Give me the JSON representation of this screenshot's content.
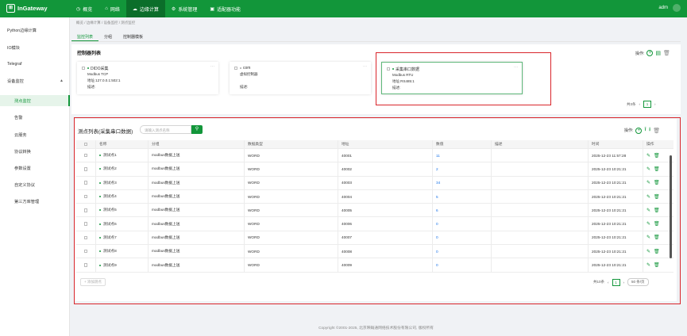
{
  "header": {
    "logo": "InGateway",
    "nav": [
      {
        "icon": "dashboard-icon",
        "label": "概览"
      },
      {
        "icon": "network-icon",
        "label": "网络"
      },
      {
        "icon": "edge-compute-icon",
        "label": "边缘计算"
      },
      {
        "icon": "system-settings-icon",
        "label": "系统管理"
      },
      {
        "icon": "app-icon",
        "label": "适配器功能"
      }
    ],
    "user": "adm"
  },
  "sidebar": {
    "items": [
      {
        "label": "Python边缘计算"
      },
      {
        "label": "IO模块"
      },
      {
        "label": "Telegraf"
      },
      {
        "label": "设备监控"
      },
      {
        "label": "测点监控"
      },
      {
        "label": "告警"
      },
      {
        "label": "云服务"
      },
      {
        "label": "协议转换"
      },
      {
        "label": "参数设置"
      },
      {
        "label": "自定义协议"
      },
      {
        "label": "第三方库管理"
      }
    ]
  },
  "breadcrumb": [
    "概览",
    "边缘计算",
    "设备监控",
    "测点监控"
  ],
  "tabs": [
    "监控列表",
    "分组",
    "控制器模板"
  ],
  "controllers": {
    "title": "控制器列表",
    "ops_label": "操作:",
    "cards": [
      {
        "name": "DIDO采集",
        "line1": "Modbus TCP",
        "line2": "地址:127.0.0.1:502:1",
        "line3": "描述:"
      },
      {
        "name": "com",
        "line1": "虚拟控制器",
        "line2": "",
        "line3": "描述:"
      },
      {
        "name": "采集串口数据",
        "line1": "Modbus RTU",
        "line2": "地址:RS485:1",
        "line3": "描述:"
      }
    ],
    "pager": {
      "total": "共3条",
      "page": "1"
    }
  },
  "points": {
    "title": "测点列表(采集串口数据)",
    "search_placeholder": "请输入测点名称",
    "ops_label": "操作:",
    "columns": [
      "名称",
      "分组",
      "数据类型",
      "地址",
      "数值",
      "描述",
      "时间",
      "操作"
    ],
    "rows": [
      {
        "name": "测试点1",
        "group": "modbus数据上送",
        "type": "WORD",
        "addr": "40001",
        "val": "11",
        "desc": "",
        "time": "2025-12-23 11:57:28"
      },
      {
        "name": "测试点2",
        "group": "modbus数据上送",
        "type": "WORD",
        "addr": "40002",
        "val": "2",
        "desc": "",
        "time": "2025-12-23 10:21:21"
      },
      {
        "name": "测试点3",
        "group": "modbus数据上送",
        "type": "WORD",
        "addr": "40003",
        "val": "34",
        "desc": "",
        "time": "2025-12-23 10:21:21"
      },
      {
        "name": "测试点4",
        "group": "modbus数据上送",
        "type": "WORD",
        "addr": "40004",
        "val": "5",
        "desc": "",
        "time": "2025-12-23 10:21:21"
      },
      {
        "name": "测试点5",
        "group": "modbus数据上送",
        "type": "WORD",
        "addr": "40005",
        "val": "6",
        "desc": "",
        "time": "2025-12-23 10:21:21"
      },
      {
        "name": "测试点6",
        "group": "modbus数据上送",
        "type": "WORD",
        "addr": "40006",
        "val": "0",
        "desc": "",
        "time": "2025-12-23 10:21:21"
      },
      {
        "name": "测试点7",
        "group": "modbus数据上送",
        "type": "WORD",
        "addr": "40007",
        "val": "0",
        "desc": "",
        "time": "2025-12-23 10:21:21"
      },
      {
        "name": "测试点8",
        "group": "modbus数据上送",
        "type": "WORD",
        "addr": "40008",
        "val": "0",
        "desc": "",
        "time": "2025-12-23 10:21:21"
      },
      {
        "name": "测试点9",
        "group": "modbus数据上送",
        "type": "WORD",
        "addr": "40009",
        "val": "0",
        "desc": "",
        "time": "2025-12-23 10:21:21"
      }
    ],
    "add_label": "+ 添加测点",
    "pager": {
      "total": "共10条",
      "page": "1",
      "size": "50 条/页"
    }
  },
  "footer": "Copyright ©2001-2025, 北京映翰通网络技术股份有限公司, 版权所有",
  "colors": {
    "brand": "#12963a",
    "highlight": "#d9252b",
    "link": "#1a73e8"
  }
}
